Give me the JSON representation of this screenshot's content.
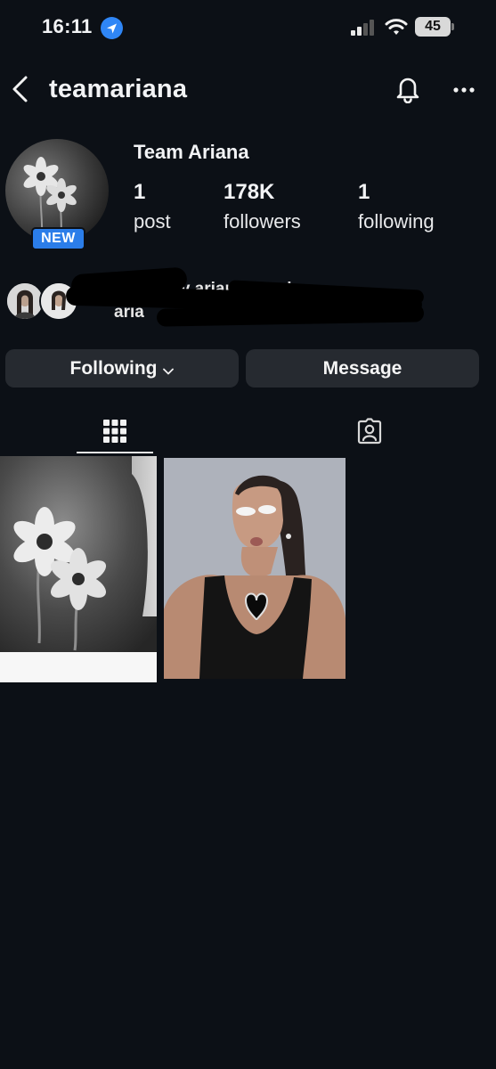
{
  "status_bar": {
    "time": "16:11",
    "battery": "45"
  },
  "header": {
    "username": "teamariana"
  },
  "profile": {
    "display_name": "Team Ariana",
    "badge": "NEW",
    "stats": [
      {
        "value": "1",
        "label": "post"
      },
      {
        "value": "178K",
        "label": "followers"
      },
      {
        "value": "1",
        "label": "following"
      }
    ]
  },
  "followed_by": {
    "line1": "wed by arianagrande",
    "line2": "aria"
  },
  "buttons": {
    "following": "Following",
    "message": "Message"
  },
  "tabs": [
    {
      "icon": "grid-icon",
      "selected": true
    },
    {
      "icon": "tagged-icon",
      "selected": false
    }
  ],
  "colors": {
    "background": "#0c1016",
    "button": "#262a30",
    "badge": "#2b7de9",
    "location": "#2f86f6"
  }
}
